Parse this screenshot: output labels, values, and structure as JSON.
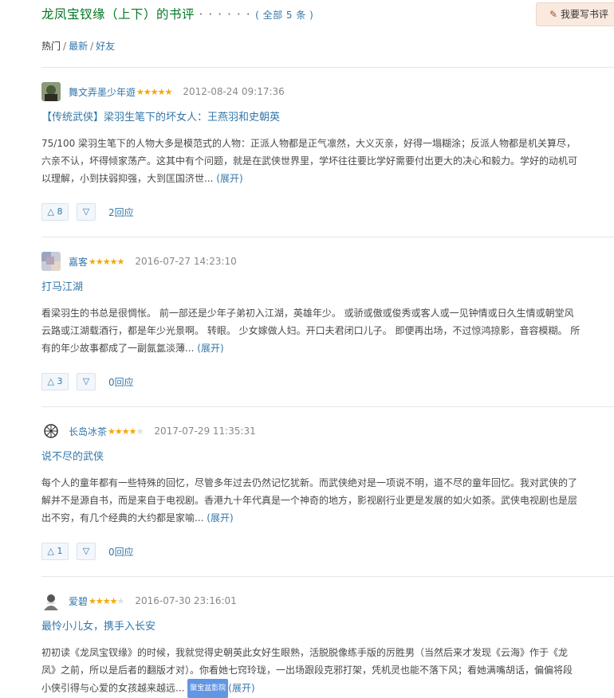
{
  "header": {
    "title": "龙凤宝钗缘（上下）的书评",
    "dots": "· · · · · ·",
    "count_label": "( 全部 5 条 )",
    "write_button": "我要写书评"
  },
  "filters": {
    "hot": "热门",
    "latest": "最新",
    "friends": "好友",
    "separator": "/"
  },
  "reviews": [
    {
      "author": "舞文弄墨少年遊",
      "stars": "★★★★★",
      "stars_off": "",
      "time": "2012-08-24 09:17:36",
      "title": "【传统武侠】梁羽生笔下的坏女人：王燕羽和史朝英",
      "body": "75/100 梁羽生笔下的人物大多是模范式的人物：正派人物都是正气凛然，大义灭亲，好得一塌糊涂；反派人物都是机关算尽，六亲不认，坏得倾家荡产。这其中有个问题，就是在武侠世界里，学坏往往要比学好需要付出更大的决心和毅力。学好的动机可以理解，小到扶弱抑强，大到匡国济世... ",
      "more": "(展开)",
      "up": "△ 8",
      "down": "▽",
      "replies": "2回应"
    },
    {
      "author": "嘉客",
      "stars": "★★★★★",
      "stars_off": "",
      "time": "2016-07-27 14:23:10",
      "title": "打马江湖",
      "body": "看梁羽生的书总是很惆怅。 前一部还是少年子弟初入江湖，英雄年少。 或骄或傲或俊秀或客人或一见钟情或日久生情或朝堂风云路或江湖载酒行，都是年少光景啊。 转眼。 少女嫁做人妇。开口夫君闭口儿子。 即便再出场，不过惊鸿掠影，音容模糊。 所有的年少故事都成了一副氤氲淡薄... ",
      "more": "(展开)",
      "up": "△ 3",
      "down": "▽",
      "replies": "0回应"
    },
    {
      "author": "长岛冰茶",
      "stars": "★★★★",
      "stars_off": "★",
      "time": "2017-07-29 11:35:31",
      "title": "说不尽的武侠",
      "body": "每个人的童年都有一些特殊的回忆，尽管多年过去仍然记忆犹新。而武侠绝对是一项说不明，道不尽的童年回忆。我对武侠的了解并不是源自书，而是来自于电视剧。香港九十年代真是一个神奇的地方，影视剧行业更是发展的如火如荼。武侠电视剧也是层出不穷，有几个经典的大约都是家喻... ",
      "more": "(展开)",
      "up": "△ 1",
      "down": "▽",
      "replies": "0回应"
    },
    {
      "author": "爱碧",
      "stars": "★★★★",
      "stars_off": "★",
      "time": "2016-07-30 23:16:01",
      "title": "最怜小儿女，携手入长安",
      "body": "初初读《龙凤宝钗缘》的时候，我就觉得史朝英此女好生眼熟，活脱脱像练手版的厉胜男（当然后来才发现《云海》作于《龙凤》之前，所以是后者的翻版才对）。你看她七窍玲珑，一出场跟段克邪打架，凭机灵也能不落下风；看她满嘴胡话，偏偏将段小侠引得与心爱的女孩越来越远... ",
      "watermark": "聚宝盆影院",
      "more": "(展开)"
    }
  ]
}
